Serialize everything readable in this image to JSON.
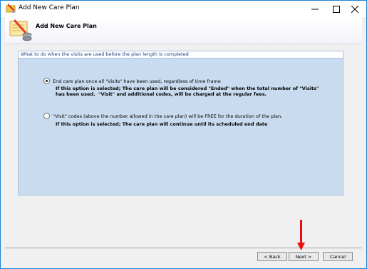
{
  "window": {
    "title": "Add New Care Plan",
    "controls": [
      "minimize-icon",
      "maximize-icon",
      "close-icon"
    ]
  },
  "header": {
    "title": "Add New Care Plan",
    "icon": "wizard-icon"
  },
  "panel": {
    "caption": "What to do when the visits are used before the plan length is completed",
    "options": [
      {
        "label": "End care plan once all \"Visits\" have been used, regardless of time frame",
        "note_line1": "If this option is selected; The care plan will be considered \"Ended\" when the total number of \"Visits\"",
        "note_line2": "has been used.  \"Visit\" and additional codes, will be charged at the regular fees.",
        "selected": true
      },
      {
        "label": "\"Visit\" codes (above the number allowed in the care plan) will be FREE for the duration of the plan.",
        "note_line1": "If this option is selected; The care plan will continue until its scheduled end date",
        "selected": false
      }
    ]
  },
  "footer": {
    "back_label": "< Back",
    "next_label": "Next >",
    "cancel_label": "Cancel"
  },
  "colors": {
    "panel_bg": "#c9dcef",
    "panel_caption": "#1a3f7a",
    "annotation_arrow": "#e8110f",
    "window_border": "#1883d7"
  }
}
